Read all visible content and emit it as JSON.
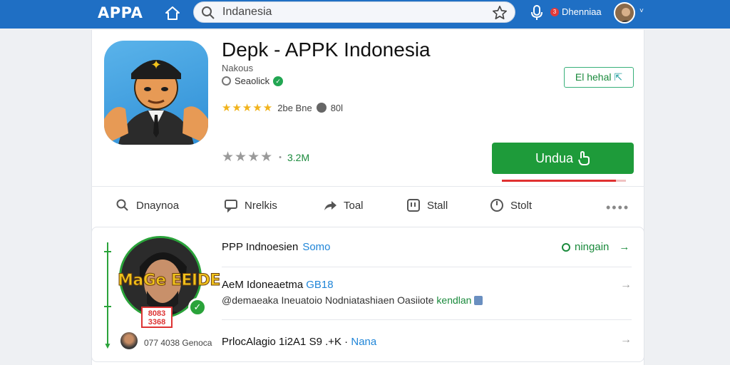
{
  "header": {
    "logo": "APPA",
    "search_value": "Indanesia",
    "notif_count": "3",
    "user_name": "Dhenniaa"
  },
  "app": {
    "title": "Depk - APPK Indonesia",
    "developer": "Nakous",
    "publisher": "Seaolick",
    "rating_text": "2be Bne",
    "reviews_text": "80l",
    "downloads": "3.2M",
    "share_label": "El hehal",
    "install_label": "Undua",
    "install_progress": 0.92,
    "colors": {
      "install": "#1e9b3a",
      "accent": "#1f6fc4"
    }
  },
  "tabs": [
    {
      "label": "Dnaynoa",
      "icon": "search-icon"
    },
    {
      "label": "Nrelkis",
      "icon": "comment-icon"
    },
    {
      "label": "Toal",
      "icon": "share-icon"
    },
    {
      "label": "Stall",
      "icon": "grid-icon"
    },
    {
      "label": "Stolt",
      "icon": "clock-icon"
    }
  ],
  "panel": {
    "portrait_caption": "MaGe EEIDE",
    "stamp_text": "8083 3368",
    "row1": {
      "title": "PPP Indnoesien",
      "tag": "Somo",
      "action": "ningain"
    },
    "row2": {
      "title": "AeM Idoneaetma",
      "tag": "GB18",
      "sub": "@demaeaka Ineuatoio Nodniatashiaen Oasiiote",
      "sub_green": "kendlan"
    },
    "row3": {
      "meta": "077 4038 Genoca",
      "title": "PrlocAlagio 1i2A1 S9 .+K · ",
      "tag": "Nana"
    }
  }
}
